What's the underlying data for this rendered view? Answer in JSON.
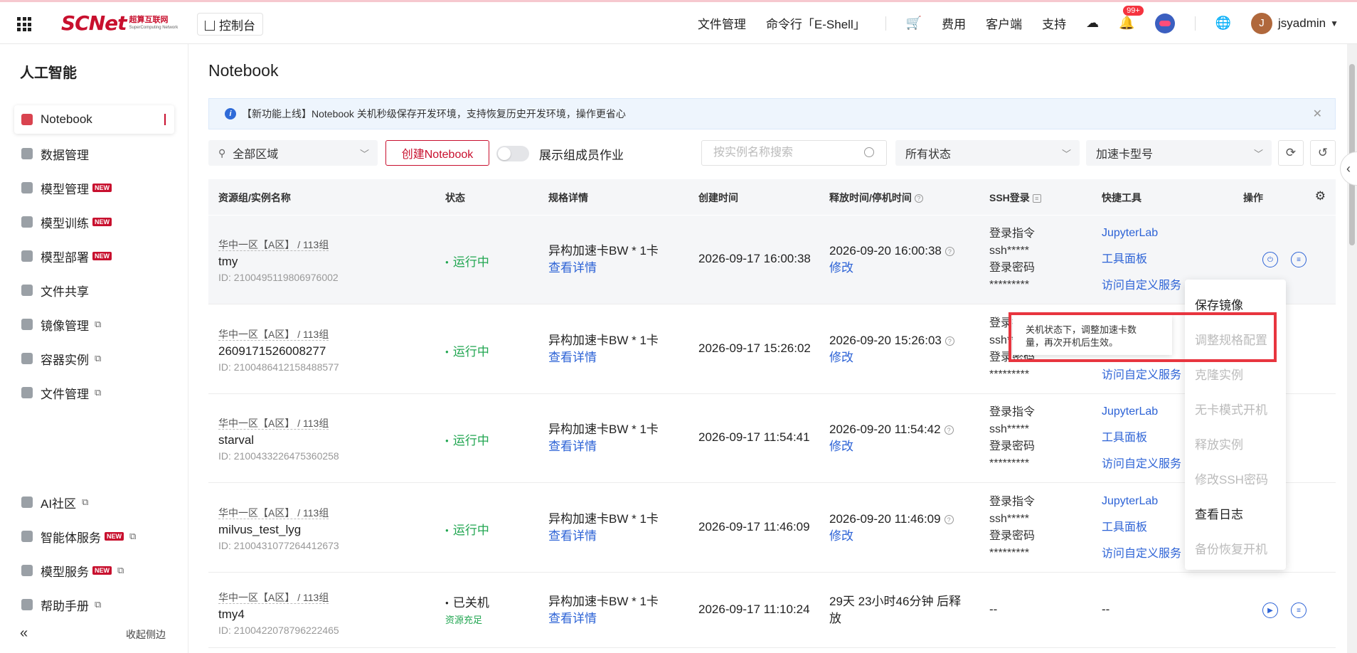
{
  "header": {
    "logo_main": "SCNet",
    "logo_cn": "超算互联网",
    "logo_en": "SuperComputing Network",
    "console": "控制台",
    "links": [
      "文件管理",
      "命令行「E-Shell」"
    ],
    "fees": "费用",
    "client": "客户端",
    "support": "支持",
    "badge": "99+",
    "avatar_letter": "J",
    "username": "jsyadmin"
  },
  "sidebar": {
    "title": "人工智能",
    "items": [
      {
        "label": "Notebook",
        "new": false,
        "ext": false
      },
      {
        "label": "数据管理",
        "new": false,
        "ext": false
      },
      {
        "label": "模型管理",
        "new": true,
        "ext": false
      },
      {
        "label": "模型训练",
        "new": true,
        "ext": false
      },
      {
        "label": "模型部署",
        "new": true,
        "ext": false
      },
      {
        "label": "文件共享",
        "new": false,
        "ext": false
      },
      {
        "label": "镜像管理",
        "new": false,
        "ext": true
      },
      {
        "label": "容器实例",
        "new": false,
        "ext": true
      },
      {
        "label": "文件管理",
        "new": false,
        "ext": true
      }
    ],
    "bottom_items": [
      {
        "label": "AI社区",
        "new": false,
        "ext": true
      },
      {
        "label": "智能体服务",
        "new": true,
        "ext": true
      },
      {
        "label": "模型服务",
        "new": true,
        "ext": true
      },
      {
        "label": "帮助手册",
        "new": false,
        "ext": true
      }
    ],
    "new_tag": "NEW",
    "collapse_label": "收起侧边"
  },
  "main": {
    "title": "Notebook",
    "notice": "【新功能上线】Notebook 关机秒级保存开发环境，支持恢复历史开发环境，操作更省心",
    "region": "全部区域",
    "create_button": "创建Notebook",
    "toggle_label": "展示组成员作业",
    "search_placeholder": "按实例名称搜索",
    "status_filter": "所有状态",
    "card_filter": "加速卡型号"
  },
  "table": {
    "headers": {
      "name": "资源组/实例名称",
      "status": "状态",
      "spec": "规格详情",
      "created": "创建时间",
      "release": "释放时间/停机时间",
      "ssh": "SSH登录",
      "tools": "快捷工具",
      "ops": "操作"
    },
    "rows": [
      {
        "group": "华中一区【A区】 / 113组",
        "name": "tmy",
        "id": "ID: 2100495119806976002",
        "status": "运行中",
        "running": true,
        "spec": "异构加速卡BW * 1卡",
        "detail": "查看详情",
        "created": "2026-09-17 16:00:38",
        "release": "2026-09-20 16:00:38",
        "modify": "修改"
      },
      {
        "group": "华中一区【A区】 / 113组",
        "name": "2609171526008277",
        "id": "ID: 2100486412158488577",
        "status": "运行中",
        "running": true,
        "spec": "异构加速卡BW * 1卡",
        "detail": "查看详情",
        "created": "2026-09-17 15:26:02",
        "release": "2026-09-20 15:26:03",
        "modify": "修改"
      },
      {
        "group": "华中一区【A区】 / 113组",
        "name": "starval",
        "id": "ID: 2100433226475360258",
        "status": "运行中",
        "running": true,
        "spec": "异构加速卡BW * 1卡",
        "detail": "查看详情",
        "created": "2026-09-17 11:54:41",
        "release": "2026-09-20 11:54:42",
        "modify": "修改"
      },
      {
        "group": "华中一区【A区】 / 113组",
        "name": "milvus_test_lyg",
        "id": "ID: 2100431077264412673",
        "status": "运行中",
        "running": true,
        "spec": "异构加速卡BW * 1卡",
        "detail": "查看详情",
        "created": "2026-09-17 11:46:09",
        "release": "2026-09-20 11:46:09",
        "modify": "修改"
      },
      {
        "group": "华中一区【A区】 / 113组",
        "name": "tmy4",
        "id": "ID: 2100422078796222465",
        "status": "已关机",
        "running": false,
        "status_sub": "资源充足",
        "spec": "异构加速卡BW * 1卡",
        "detail": "查看详情",
        "created": "2026-09-17 11:10:24",
        "release": "29天 23小时46分钟 后释",
        "release2": "放"
      }
    ],
    "ssh": {
      "cmd_label": "登录指令",
      "cmd": "ssh*****",
      "pwd_label": "登录密码",
      "pwd": "*********"
    },
    "tools": [
      "JupyterLab",
      "工具面板",
      "访问自定义服务"
    ],
    "dash": "--"
  },
  "menu": {
    "items": [
      {
        "label": "保存镜像",
        "enabled": true
      },
      {
        "label": "调整规格配置",
        "enabled": false
      },
      {
        "label": "克隆实例",
        "enabled": false
      },
      {
        "label": "无卡模式开机",
        "enabled": false
      },
      {
        "label": "释放实例",
        "enabled": false
      },
      {
        "label": "修改SSH密码",
        "enabled": false
      },
      {
        "label": "查看日志",
        "enabled": true
      },
      {
        "label": "备份恢复开机",
        "enabled": false
      }
    ],
    "tooltip_line1": "关机状态下，调整加速卡数",
    "tooltip_line2": "量，再次开机后生效。"
  },
  "colors": {
    "brand": "#c8102e",
    "link": "#2d63d6",
    "running": "#21a651",
    "highlight": "#e8353f"
  }
}
